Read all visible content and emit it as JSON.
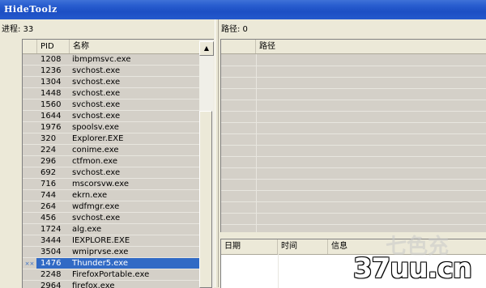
{
  "window": {
    "title": "HideToolz"
  },
  "process_panel": {
    "count_label": "进程: 33",
    "columns": [
      "",
      "PID",
      "名称"
    ],
    "rows": [
      {
        "flag": "",
        "pid": "1208",
        "name": "ibmpmsvc.exe"
      },
      {
        "flag": "",
        "pid": "1236",
        "name": "svchost.exe"
      },
      {
        "flag": "",
        "pid": "1304",
        "name": "svchost.exe"
      },
      {
        "flag": "",
        "pid": "1448",
        "name": "svchost.exe"
      },
      {
        "flag": "",
        "pid": "1560",
        "name": "svchost.exe"
      },
      {
        "flag": "",
        "pid": "1644",
        "name": "svchost.exe"
      },
      {
        "flag": "",
        "pid": "1976",
        "name": "spoolsv.exe"
      },
      {
        "flag": "",
        "pid": "320",
        "name": "Explorer.EXE"
      },
      {
        "flag": "",
        "pid": "224",
        "name": "conime.exe"
      },
      {
        "flag": "",
        "pid": "296",
        "name": "ctfmon.exe"
      },
      {
        "flag": "",
        "pid": "692",
        "name": "svchost.exe"
      },
      {
        "flag": "",
        "pid": "716",
        "name": "mscorsvw.exe"
      },
      {
        "flag": "",
        "pid": "744",
        "name": "ekrn.exe"
      },
      {
        "flag": "",
        "pid": "264",
        "name": "wdfmgr.exe"
      },
      {
        "flag": "",
        "pid": "456",
        "name": "svchost.exe"
      },
      {
        "flag": "",
        "pid": "1724",
        "name": "alg.exe"
      },
      {
        "flag": "",
        "pid": "3444",
        "name": "IEXPLORE.EXE"
      },
      {
        "flag": "",
        "pid": "3504",
        "name": "wmiprvse.exe"
      },
      {
        "flag": "××",
        "pid": "1476",
        "name": "Thunder5.exe",
        "selected": true
      },
      {
        "flag": "",
        "pid": "2248",
        "name": "FirefoxPortable.exe"
      },
      {
        "flag": "",
        "pid": "2964",
        "name": "firefox.exe"
      }
    ],
    "scroll_up_icon": "▲"
  },
  "path_panel": {
    "count_label": "路径: 0",
    "columns": [
      "",
      "路径"
    ]
  },
  "log_panel": {
    "columns": [
      "日期",
      "时间",
      "信息"
    ]
  },
  "watermark": {
    "text": "37uu.cn",
    "faint_text": "七色充"
  }
}
